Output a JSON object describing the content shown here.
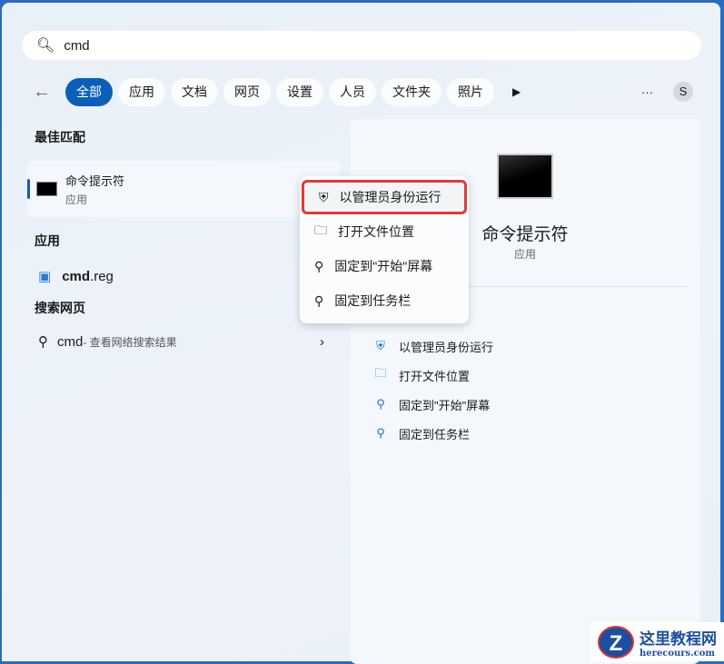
{
  "search": {
    "value": "cmd"
  },
  "filters": [
    "全部",
    "应用",
    "文档",
    "网页",
    "设置",
    "人员",
    "文件夹",
    "照片"
  ],
  "avatar": "S",
  "best_match": {
    "heading": "最佳匹配",
    "name": "命令提示符",
    "type": "应用"
  },
  "apps": {
    "heading": "应用",
    "item_bold": "cmd",
    "item_rest": ".reg"
  },
  "web": {
    "heading": "搜索网页",
    "query": "cmd",
    "suffix": " - 查看网络搜索结果"
  },
  "context_menu": [
    "以管理员身份运行",
    "打开文件位置",
    "固定到\"开始\"屏幕",
    "固定到任务栏"
  ],
  "detail": {
    "title": "命令提示符",
    "type": "应用",
    "actions": [
      "以管理员身份运行",
      "打开文件位置",
      "固定到\"开始\"屏幕",
      "固定到任务栏"
    ]
  },
  "watermark": {
    "name": "这里教程网",
    "url": "herecours.com"
  }
}
